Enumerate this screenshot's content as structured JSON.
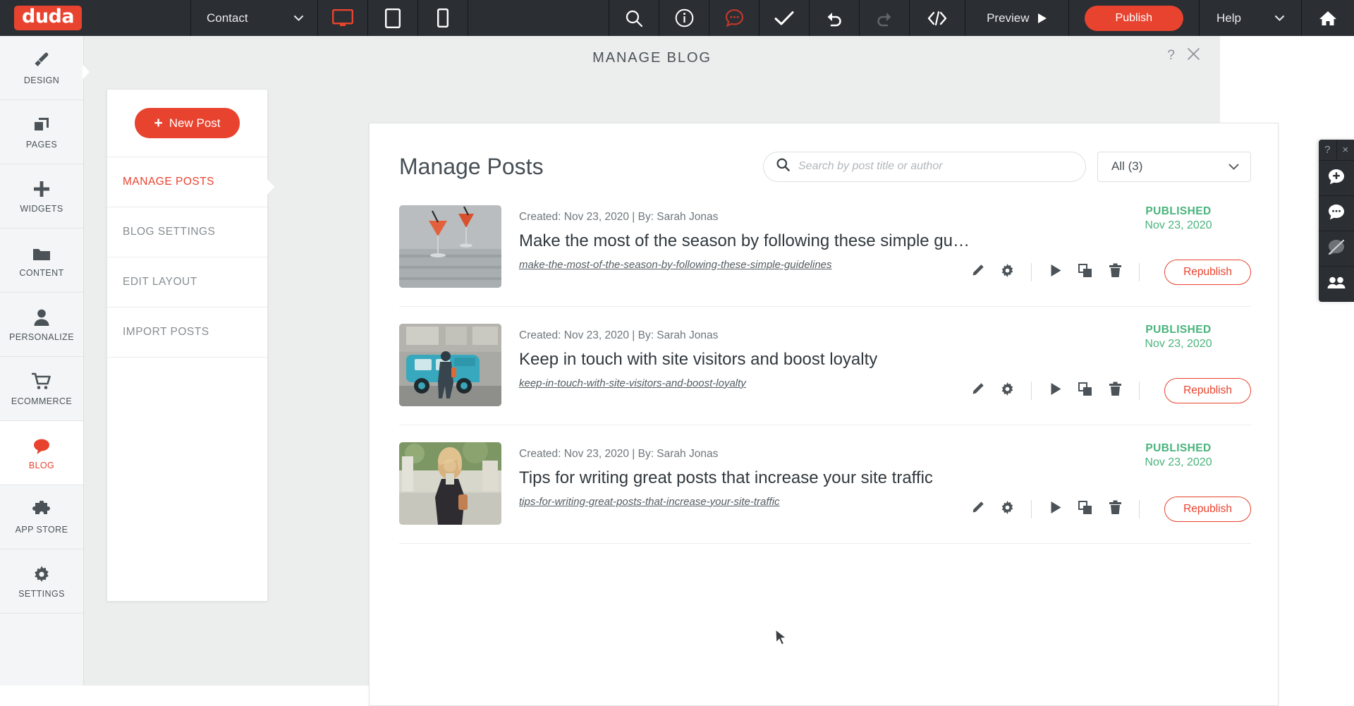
{
  "topbar": {
    "logo_text": "duda",
    "page_selector": {
      "label": "Contact",
      "icon": "chevron-down-icon"
    },
    "device_buttons": [
      {
        "name": "desktop-view",
        "icon": "desktop-icon",
        "active": true
      },
      {
        "name": "tablet-view",
        "icon": "tablet-icon",
        "active": false
      },
      {
        "name": "mobile-view",
        "icon": "mobile-icon",
        "active": false
      }
    ],
    "tools": [
      {
        "name": "search",
        "icon": "search-icon"
      },
      {
        "name": "info",
        "icon": "info-circle-icon"
      },
      {
        "name": "comments",
        "icon": "comment-dots-icon"
      },
      {
        "name": "checklist",
        "icon": "check-icon"
      },
      {
        "name": "undo",
        "icon": "undo-icon"
      },
      {
        "name": "redo",
        "icon": "redo-icon"
      },
      {
        "name": "code",
        "icon": "code-brackets-icon"
      }
    ],
    "preview_label": "Preview",
    "publish_label": "Publish",
    "help_label": "Help",
    "home_icon": "home-icon",
    "accent_color": "#e8432f",
    "background_color": "#2b2e33"
  },
  "sidebar": {
    "items": [
      {
        "label": "DESIGN",
        "icon": "brush-icon",
        "active": false
      },
      {
        "label": "PAGES",
        "icon": "pages-stack-icon",
        "active": false
      },
      {
        "label": "WIDGETS",
        "icon": "plus-icon",
        "active": false
      },
      {
        "label": "CONTENT",
        "icon": "folder-icon",
        "active": false
      },
      {
        "label": "PERSONALIZE",
        "icon": "person-icon",
        "active": false
      },
      {
        "label": "ECOMMERCE",
        "icon": "cart-icon",
        "active": false
      },
      {
        "label": "BLOG",
        "icon": "speech-bubble-icon",
        "active": true
      },
      {
        "label": "APP STORE",
        "icon": "puzzle-icon",
        "active": false
      },
      {
        "label": "SETTINGS",
        "icon": "gear-icon",
        "active": false
      }
    ]
  },
  "modal": {
    "title": "MANAGE BLOG",
    "help_icon": "question-mark-icon",
    "close_icon": "close-icon",
    "nav": {
      "new_post_label": "New Post",
      "items": [
        {
          "label": "MANAGE POSTS",
          "active": true
        },
        {
          "label": "BLOG SETTINGS",
          "active": false
        },
        {
          "label": "EDIT LAYOUT",
          "active": false
        },
        {
          "label": "IMPORT POSTS",
          "active": false
        }
      ]
    },
    "panel": {
      "heading": "Manage Posts",
      "search": {
        "placeholder": "Search by post title or author",
        "value": "",
        "icon": "search-icon"
      },
      "filter": {
        "selected": "All (3)",
        "icon": "chevron-down-icon"
      },
      "row_actions": [
        {
          "name": "edit-post",
          "icon": "pencil-icon"
        },
        {
          "name": "post-settings",
          "icon": "gear-icon"
        },
        {
          "name": "preview-post",
          "icon": "play-icon"
        },
        {
          "name": "duplicate-post",
          "icon": "duplicate-icon"
        },
        {
          "name": "delete-post",
          "icon": "trash-icon"
        }
      ],
      "republish_label": "Republish",
      "status_color": "#49b37c",
      "posts": [
        {
          "created_label": "Created: Nov 23, 2020 | By: Sarah Jonas",
          "title": "Make the most of the season by following these simple gu…",
          "slug": "make-the-most-of-the-season-by-following-these-simple-guidelines",
          "status": "PUBLISHED",
          "status_date": "Nov 23, 2020",
          "thumb": "cocktails-on-table"
        },
        {
          "created_label": "Created: Nov 23, 2020 | By: Sarah Jonas",
          "title": "Keep in touch with site visitors and boost loyalty",
          "slug": "keep-in-touch-with-site-visitors-and-boost-loyalty",
          "status": "PUBLISHED",
          "status_date": "Nov 23, 2020",
          "thumb": "blue-food-van"
        },
        {
          "created_label": "Created: Nov 23, 2020 | By: Sarah Jonas",
          "title": "Tips for writing great posts that increase your site traffic",
          "slug": "tips-for-writing-great-posts-that-increase-your-site-traffic",
          "status": "PUBLISHED",
          "status_date": "Nov 23, 2020",
          "thumb": "woman-with-coffee"
        }
      ]
    }
  },
  "right_panel": {
    "help_label": "?",
    "close_label": "×",
    "items": [
      {
        "name": "add-comment",
        "icon": "comment-plus-icon"
      },
      {
        "name": "chat",
        "icon": "comment-dots-icon"
      },
      {
        "name": "hide-annotations",
        "icon": "eye-slash-icon"
      },
      {
        "name": "collaborators",
        "icon": "people-icon"
      }
    ]
  }
}
